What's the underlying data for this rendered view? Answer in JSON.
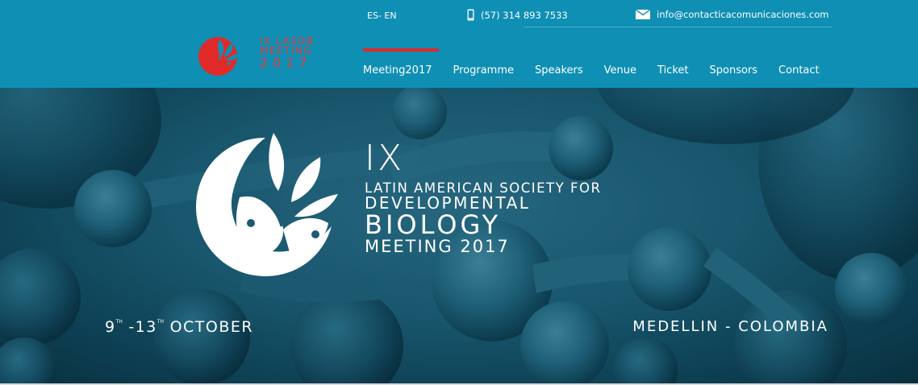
{
  "topbar": {
    "lang_es": "ES",
    "lang_sep": "-",
    "lang_en": "EN",
    "phone": "(57) 314 893 7533",
    "email": "info@contacticacomunicaciones.com",
    "phone_icon": "phone-icon",
    "email_icon": "envelope-icon"
  },
  "logo": {
    "line1": "IX LASDB",
    "line2": "MEETING",
    "line3": "2017"
  },
  "nav": [
    {
      "label": "Meeting2017",
      "active": true
    },
    {
      "label": "Programme"
    },
    {
      "label": "Speakers"
    },
    {
      "label": "Venue"
    },
    {
      "label": "Ticket"
    },
    {
      "label": "Sponsors"
    },
    {
      "label": "Contact"
    }
  ],
  "hero": {
    "roman": "IX",
    "line1": "LATIN AMERICAN SOCIETY FOR",
    "line2": "DEVELOPMENTAL",
    "line3": "BIOLOGY",
    "line4": "MEETING 2017",
    "date_start": "9",
    "date_start_sup": "TH",
    "date_sep": " -13",
    "date_end_sup": "TH",
    "date_month": " OCTOBER",
    "location": "MEDELLIN - COLOMBIA"
  },
  "colors": {
    "header_bg": "#0f8fb4",
    "accent_red": "#e02a2a",
    "logo_red": "#e63939",
    "text": "#ffffff"
  }
}
